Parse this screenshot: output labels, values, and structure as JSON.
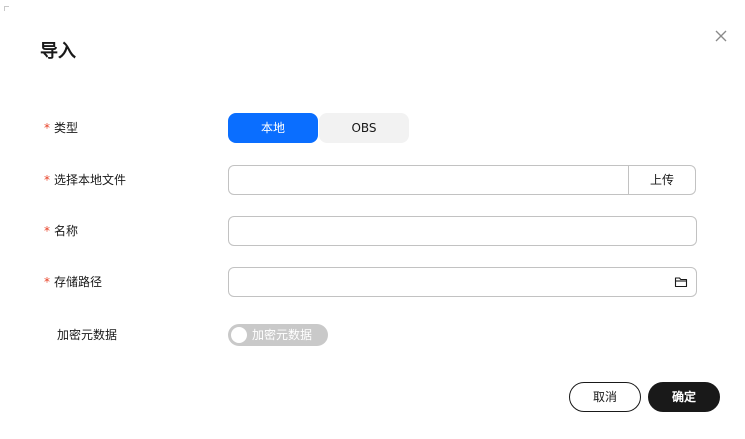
{
  "dialog": {
    "title": "导入"
  },
  "form": {
    "type": {
      "required_mark": "*",
      "label": "类型",
      "options": [
        "本地",
        "OBS"
      ],
      "selected": "本地"
    },
    "local_file": {
      "required_mark": "*",
      "label": "选择本地文件",
      "value": "",
      "upload_label": "上传"
    },
    "name": {
      "required_mark": "*",
      "label": "名称",
      "value": ""
    },
    "storage_path": {
      "required_mark": "*",
      "label": "存储路径",
      "value": "",
      "icon": "folder-icon"
    },
    "encrypt_metadata": {
      "label": "加密元数据",
      "toggle_text": "加密元数据",
      "enabled": false
    }
  },
  "footer": {
    "cancel_label": "取消",
    "ok_label": "确定"
  },
  "colors": {
    "accent": "#0a6eff",
    "required": "#e84026",
    "primary_button": "#191919",
    "toggle_off": "#c9c9c9"
  }
}
